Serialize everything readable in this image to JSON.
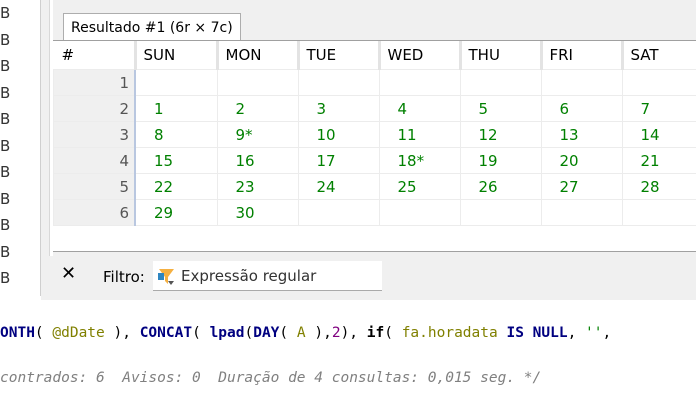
{
  "left_strip": [
    "B",
    "B",
    "B",
    "B",
    "B",
    "B",
    "B",
    "B",
    "B",
    "B",
    "B"
  ],
  "tab": {
    "label": "Resultado #1 (6r × 7c)"
  },
  "grid": {
    "columns": [
      "#",
      "SUN",
      "MON",
      "TUE",
      "WED",
      "THU",
      "FRI",
      "SAT"
    ],
    "rows": [
      {
        "n": "1",
        "cells": [
          "",
          "",
          "",
          "",
          "",
          "",
          ""
        ]
      },
      {
        "n": "2",
        "cells": [
          "1",
          "2",
          "3",
          "4",
          "5",
          "6",
          "7"
        ]
      },
      {
        "n": "3",
        "cells": [
          "8",
          "9*",
          "10",
          "11",
          "12",
          "13",
          "14"
        ]
      },
      {
        "n": "4",
        "cells": [
          "15",
          "16",
          "17",
          "18*",
          "19",
          "20",
          "21"
        ]
      },
      {
        "n": "5",
        "cells": [
          "22",
          "23",
          "24",
          "25",
          "26",
          "27",
          "28"
        ]
      },
      {
        "n": "6",
        "cells": [
          "29",
          "30",
          "",
          "",
          "",
          "",
          ""
        ]
      }
    ],
    "value_color": "#008000"
  },
  "filter": {
    "close": "✕",
    "label": "Filtro:",
    "placeholder": "Expressão regular"
  },
  "editor": {
    "code_tokens": [
      {
        "t": "ONTH",
        "c": "kw"
      },
      {
        "t": "( ",
        "c": "pl"
      },
      {
        "t": "@dDate",
        "c": "var"
      },
      {
        "t": " ), ",
        "c": "pl"
      },
      {
        "t": "CONCAT",
        "c": "kw"
      },
      {
        "t": "( ",
        "c": "pl"
      },
      {
        "t": "lpad",
        "c": "kw"
      },
      {
        "t": "(",
        "c": "pl"
      },
      {
        "t": "DAY",
        "c": "kw"
      },
      {
        "t": "( ",
        "c": "pl"
      },
      {
        "t": "A",
        "c": "var"
      },
      {
        "t": " ),",
        "c": "pl"
      },
      {
        "t": "2",
        "c": "nm"
      },
      {
        "t": "), ",
        "c": "pl"
      },
      {
        "t": "if",
        "c": "kb"
      },
      {
        "t": "( ",
        "c": "pl"
      },
      {
        "t": "fa.horadata",
        "c": "var"
      },
      {
        "t": " ",
        "c": "pl"
      },
      {
        "t": "IS NULL",
        "c": "kw"
      },
      {
        "t": ", ",
        "c": "pl"
      },
      {
        "t": "''",
        "c": "st"
      },
      {
        "t": ",",
        "c": "pl"
      }
    ],
    "comment": "contrados: 6  Avisos: 0  Duração de 4 consultas: 0,015 seg. */"
  }
}
